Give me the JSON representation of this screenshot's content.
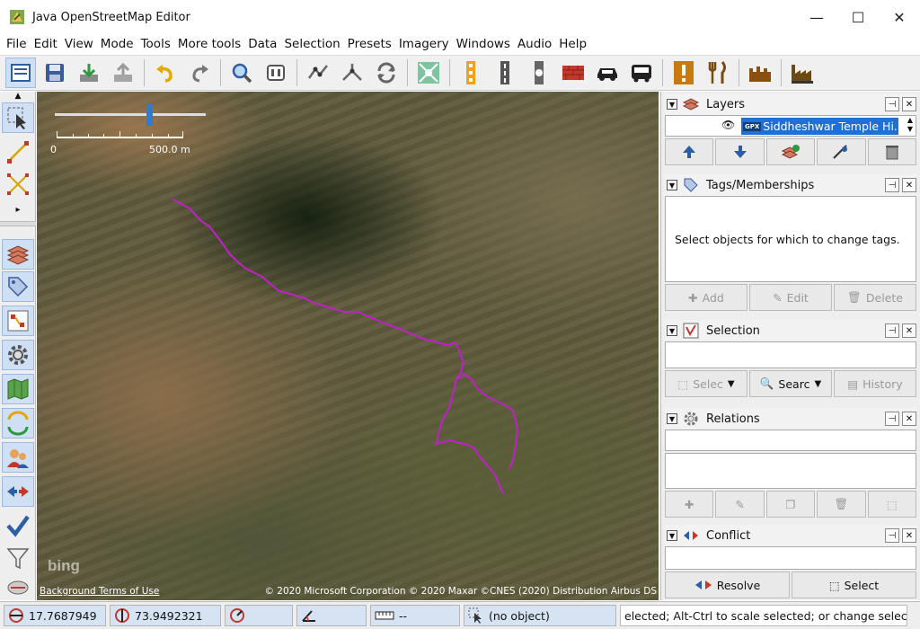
{
  "window": {
    "title": "Java OpenStreetMap Editor",
    "controls": {
      "minimize": "—",
      "maximize": "☐",
      "close": "✕"
    }
  },
  "menubar": [
    "File",
    "Edit",
    "View",
    "Mode",
    "Tools",
    "More tools",
    "Data",
    "Selection",
    "Presets",
    "Imagery",
    "Windows",
    "Audio",
    "Help"
  ],
  "toolbar": {
    "icons": [
      "open-file-icon",
      "save-icon",
      "download-icon",
      "upload-icon",
      "undo-icon",
      "redo-icon",
      "zoom-icon",
      "preferences-icon",
      "split-way-icon",
      "combine-way-icon",
      "reverse-way-icon",
      "map-paint-icon",
      "traffic-signal-icon",
      "road-icon",
      "crossing-icon",
      "wall-icon",
      "car-icon",
      "bus-icon",
      "warning-icon",
      "restaurant-icon",
      "castle-icon",
      "factory-icon"
    ]
  },
  "lefttoolbar": {
    "icons": [
      "select-mode-icon",
      "draw-mode-icon",
      "improve-way-icon",
      "layers-icon",
      "tags-icon",
      "selection-list-icon",
      "preferences-icon",
      "map-icon",
      "changeset-icon",
      "user-icon",
      "conflict-icon",
      "validator-icon",
      "filter-icon",
      "minimap-icon"
    ]
  },
  "map": {
    "scale_start": "0",
    "scale_end": "500.0 m",
    "bing_logo": "bing",
    "background_terms": "Background Terms of Use",
    "copyright": "© 2020 Microsoft Corporation © 2020 Maxar ©CNES (2020) Distribution Airbus DS",
    "track_color": "#c020c8"
  },
  "panels": {
    "layers": {
      "title": "Layers",
      "layer_name": "Siddheshwar Temple Hi...",
      "layer_badge": "GPX",
      "buttons": [
        "move-up-icon",
        "move-down-icon",
        "merge-layer-icon",
        "toggle-visibility-icon",
        "delete-layer-icon"
      ]
    },
    "tags": {
      "title": "Tags/Memberships",
      "message": "Select objects for which to change tags.",
      "add": "Add",
      "edit": "Edit",
      "delete": "Delete"
    },
    "selection": {
      "title": "Selection",
      "select": "Selec",
      "search": "Searc",
      "history": "History"
    },
    "relations": {
      "title": "Relations"
    },
    "conflict": {
      "title": "Conflict",
      "resolve": "Resolve",
      "select": "Select"
    }
  },
  "statusbar": {
    "lat": "17.7687949",
    "lon": "73.9492321",
    "heading": "",
    "angle": "",
    "distance": "--",
    "selection": "(no object)",
    "hint": "elected; Alt-Ctrl to scale selected; or change selection"
  },
  "colors": {
    "accent": "#2c7bd6",
    "active_bg": "#cfe0f5",
    "track": "#c020c8"
  }
}
